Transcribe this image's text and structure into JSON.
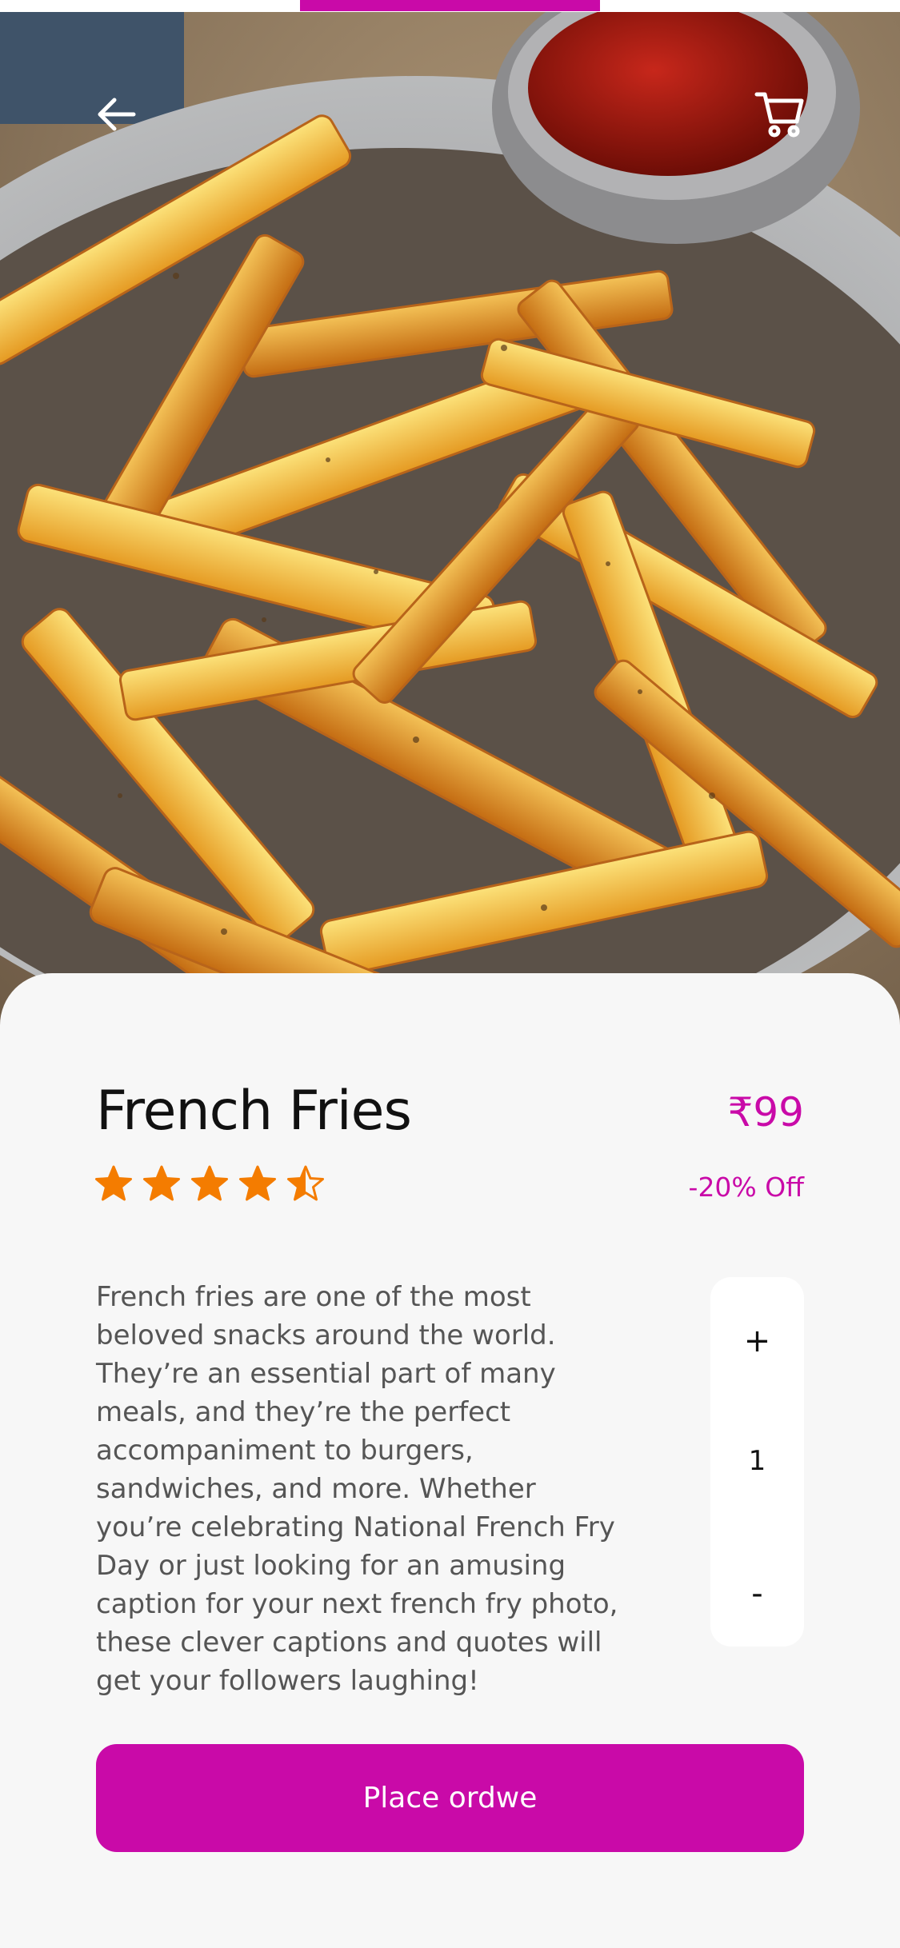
{
  "product": {
    "title": "French Fries",
    "price": "₹99",
    "discount": "-20% Off",
    "rating": 4.5,
    "rating_max": 5,
    "description": "French fries are one of the most beloved snacks around the world. They’re an essential part of many meals, and they’re the perfect accompaniment to burgers, sandwiches, and more. Whether you’re celebrating National French Fry Day or just looking for an amusing caption for your next french fry photo, these clever captions and quotes will get your followers laughing!"
  },
  "quantity": {
    "plus_label": "+",
    "value": "1",
    "minus_label": "-"
  },
  "order": {
    "button_label": "Place ordwe"
  },
  "icons": {
    "back": "arrow-left-icon",
    "cart": "shopping-cart-icon",
    "star": "star-icon"
  },
  "colors": {
    "accent": "#c90aa8",
    "star": "#f47c00",
    "card_background": "#f7f7f7"
  }
}
